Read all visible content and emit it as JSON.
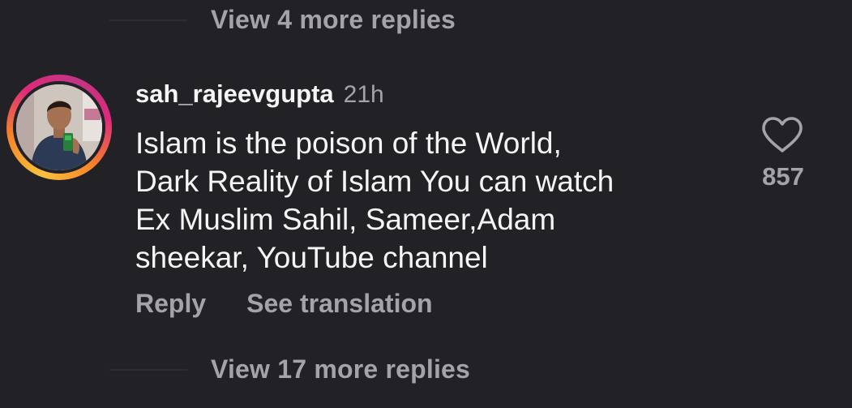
{
  "thread": {
    "view_more_top": "View 4 more replies",
    "view_more_bottom": "View 17 more replies"
  },
  "comment": {
    "username": "sah_rajeevgupta",
    "timestamp": "21h",
    "text": "Islam is the poison of the World,\nDark Reality of Islam You can watch\nEx Muslim Sahil, Sameer,Adam\nsheekar, YouTube channel",
    "like_count": "857",
    "reply_label": "Reply",
    "translate_label": "See translation",
    "avatar_icon": "profile-photo",
    "like_icon": "heart-outline-icon"
  },
  "colors": {
    "background": "#212126",
    "primary_text": "#f5f5f5",
    "secondary_text": "#a3a3a8",
    "story_ring_start": "#f9c23c",
    "story_ring_end": "#c13584"
  }
}
